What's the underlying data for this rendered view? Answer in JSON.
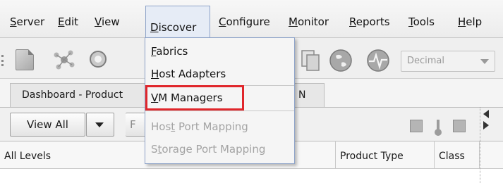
{
  "menubar": {
    "items": [
      {
        "label": "Server",
        "mnemonic_index": 0
      },
      {
        "label": "Edit",
        "mnemonic_index": 0
      },
      {
        "label": "View",
        "mnemonic_index": 0
      },
      {
        "label": "Discover",
        "mnemonic_index": 0
      },
      {
        "label": "Configure",
        "mnemonic_index": 0
      },
      {
        "label": "Monitor",
        "mnemonic_index": 0
      },
      {
        "label": "Reports",
        "mnemonic_index": 0
      },
      {
        "label": "Tools",
        "mnemonic_index": 0
      },
      {
        "label": "Help",
        "mnemonic_index": 0
      }
    ],
    "open_menu": "Discover"
  },
  "toolbar": {
    "number_format": "Decimal",
    "icons": [
      "document-icon",
      "discover-icon",
      "search-icon",
      "copy-icon",
      "globe-icon",
      "pulse-icon"
    ]
  },
  "tabs": [
    {
      "label": "Dashboard - Product"
    },
    {
      "label": "N"
    }
  ],
  "subbar": {
    "view_all_label": "View All",
    "partial_label": "F"
  },
  "table": {
    "columns": [
      "All Levels",
      "Product Type",
      "Class"
    ]
  },
  "discover_menu": {
    "items": [
      {
        "label": "Fabrics",
        "mnemonic": "F",
        "enabled": true
      },
      {
        "label": "Host Adapters",
        "mnemonic": "H",
        "enabled": true
      },
      {
        "label": "VM Managers",
        "mnemonic": "V",
        "enabled": true,
        "highlighted": true
      },
      {
        "label": "Host Port Mapping",
        "mnemonic": "t",
        "enabled": false
      },
      {
        "label": "Storage Port Mapping",
        "mnemonic": "t",
        "enabled": false
      }
    ],
    "highlight_color": "#e0262b"
  }
}
